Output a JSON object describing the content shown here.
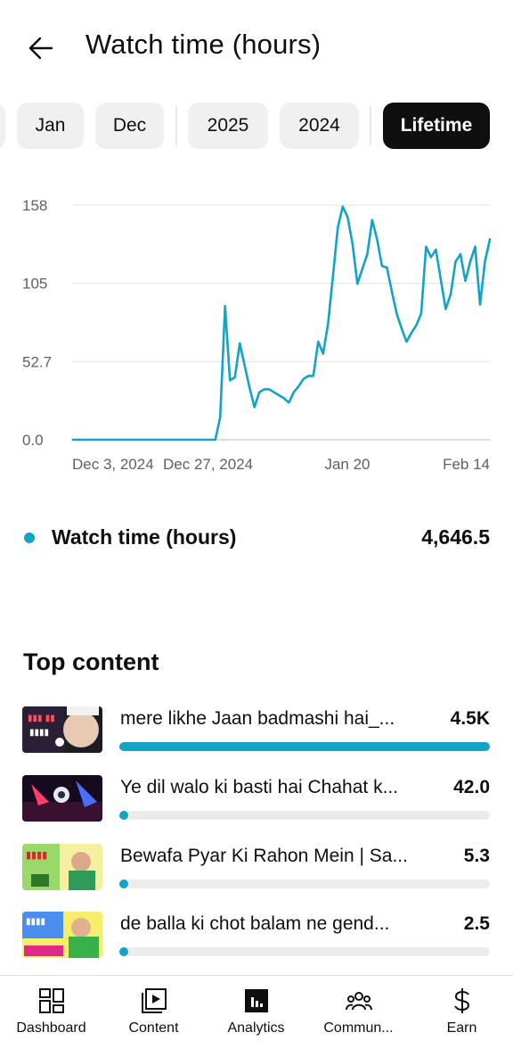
{
  "header": {
    "title": "Watch time (hours)",
    "back_icon": "arrow-left-icon"
  },
  "chips": [
    "Jan",
    "Dec",
    "2025",
    "2024",
    "Lifetime"
  ],
  "chip_selected": "Lifetime",
  "chart_data": {
    "type": "line",
    "title": "",
    "xlabel": "",
    "ylabel": "",
    "ylim": [
      0,
      158
    ],
    "y_ticks": [
      "158",
      "105",
      "52.7",
      "0.0"
    ],
    "x_tick_labels": [
      "Dec 3, 2024",
      "Dec 27, 2024",
      "Jan 20",
      "Feb 14"
    ],
    "grid": true,
    "color": "#12a3c5",
    "series": [
      {
        "values": [
          0,
          0,
          0,
          0,
          0,
          0,
          0,
          0,
          0,
          0,
          0,
          0,
          0,
          0,
          0,
          0,
          0,
          0,
          0,
          0,
          0,
          0,
          0,
          0,
          0,
          0,
          0,
          0,
          0,
          0,
          15,
          90,
          40,
          42,
          65,
          50,
          35,
          22,
          32,
          34,
          34,
          32,
          30,
          28,
          25,
          32,
          36,
          41,
          43,
          43,
          66,
          58,
          78,
          110,
          143,
          157,
          150,
          132,
          105,
          115,
          125,
          148,
          135,
          117,
          116,
          100,
          85,
          75,
          66,
          72,
          77,
          85,
          130,
          123,
          128,
          108,
          88,
          98,
          120,
          125,
          107,
          120,
          130,
          91,
          120,
          135
        ]
      }
    ]
  },
  "legend": {
    "label": "Watch time (hours)",
    "total": "4,646.5"
  },
  "top_content": {
    "title": "Top content",
    "items": [
      {
        "title": "mere likhe Jaan badmashi hai_...",
        "value": "4.5K",
        "fraction": 1.0
      },
      {
        "title": "Ye dil walo ki basti hai Chahat k...",
        "value": "42.0",
        "fraction": 0.0093
      },
      {
        "title": "Bewafa Pyar Ki Rahon Mein | Sa...",
        "value": "5.3",
        "fraction": 0.0012
      },
      {
        "title": "de balla ki chot balam ne gend...",
        "value": "2.5",
        "fraction": 0.0006
      }
    ]
  },
  "nav": [
    {
      "label": "Dashboard",
      "icon": "dashboard-icon"
    },
    {
      "label": "Content",
      "icon": "content-icon"
    },
    {
      "label": "Analytics",
      "icon": "analytics-icon"
    },
    {
      "label": "Commun...",
      "icon": "community-icon"
    },
    {
      "label": "Earn",
      "icon": "dollar-icon"
    }
  ]
}
